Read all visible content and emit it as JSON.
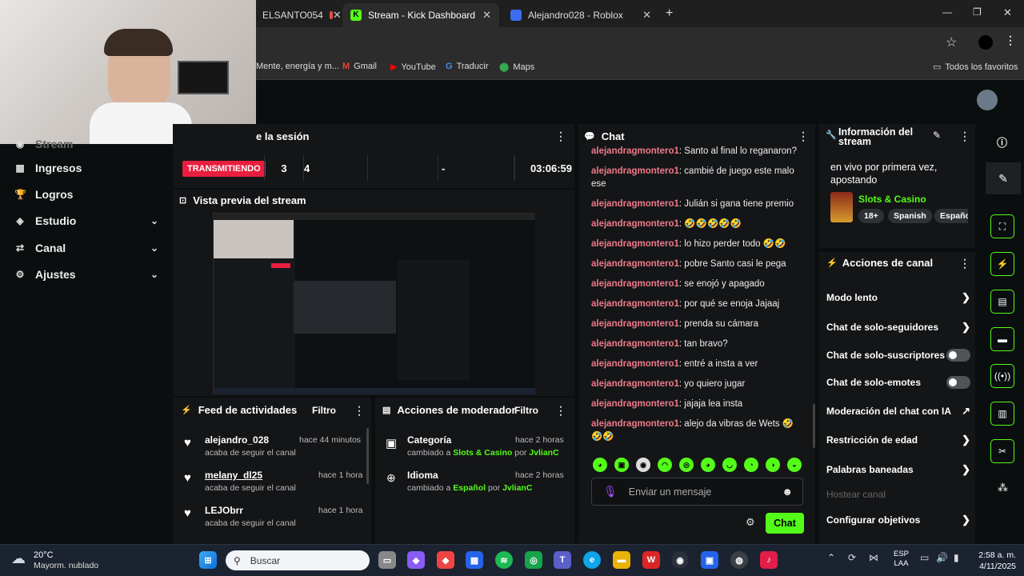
{
  "browser": {
    "tabs": [
      {
        "title": "ELSANTO054",
        "active": false
      },
      {
        "title": "Stream - Kick Dashboard",
        "active": true
      },
      {
        "title": "Alejandro028 - Roblox",
        "active": false
      }
    ],
    "new_tab": "+",
    "bookmarks": [
      "Mente, energía y m...",
      "Gmail",
      "YouTube",
      "Traducir",
      "Maps"
    ],
    "all_bookmarks": "Todos los favoritos"
  },
  "sidebar": {
    "items": [
      {
        "label": "Stream",
        "icon": "broadcast-icon"
      },
      {
        "label": "Ingresos",
        "icon": "money-icon"
      },
      {
        "label": "Logros",
        "icon": "trophy-icon"
      },
      {
        "label": "Estudio",
        "icon": "studio-icon"
      },
      {
        "label": "Canal",
        "icon": "channel-icon"
      },
      {
        "label": "Ajustes",
        "icon": "gear-icon"
      }
    ]
  },
  "session": {
    "title": "e la sesión",
    "status": "TRANSMITIENDO",
    "stats": [
      "3",
      "4",
      "-",
      "03:06:59"
    ]
  },
  "preview": {
    "title": "Vista previa del stream"
  },
  "activity": {
    "title": "Feed de actividades",
    "filter": "Filtro",
    "items": [
      {
        "name": "alejandro_028",
        "time": "hace 44 minutos",
        "sub": "acaba de seguir el canal"
      },
      {
        "name": "melany_dl25",
        "time": "hace 1 hora",
        "sub": "acaba de seguir el canal"
      },
      {
        "name": "LEJObrr",
        "time": "hace 1 hora",
        "sub": "acaba de seguir el canal"
      }
    ]
  },
  "moderator": {
    "title": "Acciones de moderador",
    "filter": "Filtro",
    "items": [
      {
        "label": "Categoría",
        "time": "hace 2 horas",
        "pre": "cambiado a ",
        "value": "Slots & Casino",
        "by": " por ",
        "user": "JvlianC"
      },
      {
        "label": "Idioma",
        "time": "hace 2 horas",
        "pre": "cambiado a ",
        "value": "Español",
        "by": " por ",
        "user": "JvlianC"
      }
    ]
  },
  "chat": {
    "title": "Chat",
    "messages": [
      {
        "user": "alejandragmontero1",
        "text": ": Santo al final lo reganaron?"
      },
      {
        "user": "alejandragmontero1",
        "text": ": cambié de juego este malo ese"
      },
      {
        "user": "alejandragmontero1",
        "text": ": Julián si gana tiene premio"
      },
      {
        "user": "alejandragmontero1",
        "text": ": 🤣🤣🤣🤣🤣"
      },
      {
        "user": "alejandragmontero1",
        "text": ": lo hizo perder todo 🤣🤣"
      },
      {
        "user": "alejandragmontero1",
        "text": ": pobre Santo casi le pega"
      },
      {
        "user": "alejandragmontero1",
        "text": ": se enojó y apagado"
      },
      {
        "user": "alejandragmontero1",
        "text": ": por qué se enoja Jajaaj"
      },
      {
        "user": "alejandragmontero1",
        "text": ": prenda su cámara"
      },
      {
        "user": "alejandragmontero1",
        "text": ": tan bravo?"
      },
      {
        "user": "alejandragmontero1",
        "text": ": entré a insta a ver"
      },
      {
        "user": "alejandragmontero1",
        "text": ": yo quiero jugar"
      },
      {
        "user": "alejandragmontero1",
        "text": ": jajaja lea insta"
      },
      {
        "user": "alejandragmontero1",
        "text": ": alejo da vibras de Wets 🤣🤣🤣"
      }
    ],
    "placeholder": "Enviar un mensaje",
    "send": "Chat"
  },
  "stream_info": {
    "title": "Información del stream",
    "description": "en vivo por primera vez, apostando",
    "category": "Slots & Casino",
    "tags": [
      "18+",
      "Spanish",
      "Españo"
    ]
  },
  "channel_actions": {
    "title": "Acciones de canal",
    "items": [
      {
        "label": "Modo lento",
        "kind": "arrow"
      },
      {
        "label": "Chat de solo-seguidores",
        "kind": "arrow"
      },
      {
        "label": "Chat de solo-suscriptores",
        "kind": "toggle"
      },
      {
        "label": "Chat de solo-emotes",
        "kind": "toggle"
      },
      {
        "label": "Moderación del chat con IA",
        "kind": "external"
      },
      {
        "label": "Restricción de edad",
        "kind": "arrow"
      },
      {
        "label": "Palabras baneadas",
        "kind": "arrow"
      },
      {
        "label": "Hostear canal",
        "kind": "disabled"
      },
      {
        "label": "Configurar objetivos",
        "kind": "arrow"
      }
    ]
  },
  "taskbar": {
    "weather_temp": "20°C",
    "weather_desc": "Mayorm. nublado",
    "search": "Buscar",
    "lang1": "ESP",
    "lang2": "LAA",
    "time": "2:58 a. m.",
    "date": "4/11/2025"
  },
  "colors": {
    "accent": "#53fc18",
    "live": "#e91e3e",
    "chat_user": "#f07a8a"
  }
}
